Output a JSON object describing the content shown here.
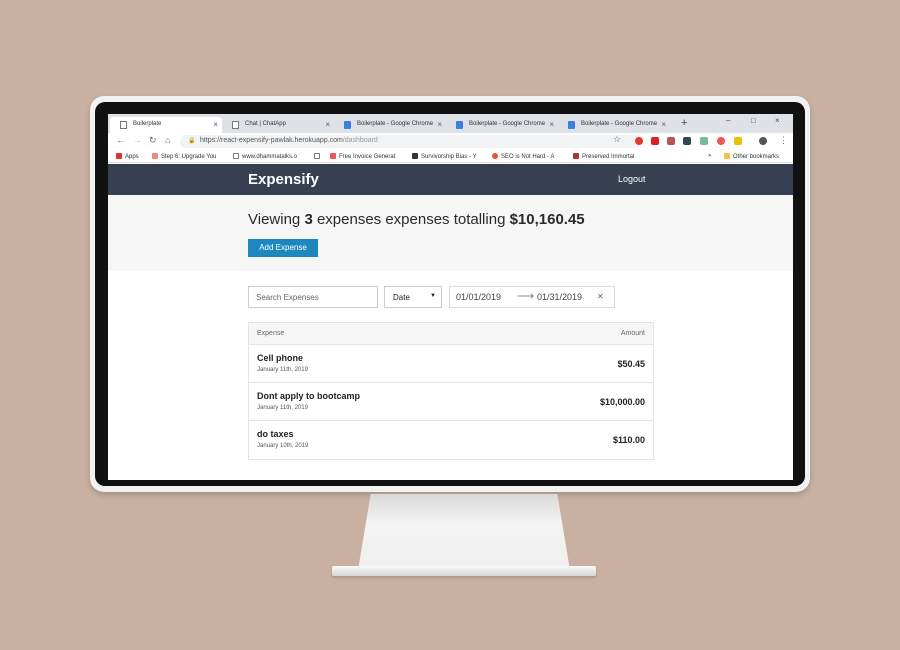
{
  "browser": {
    "tabs": [
      {
        "label": "Boilerplate",
        "favicon": "page-icon",
        "active": true
      },
      {
        "label": "Chat | ChatApp",
        "favicon": "page-icon",
        "active": false
      },
      {
        "label": "Boilerplate - Google Chrome",
        "favicon": "chrome-window-icon",
        "active": false
      },
      {
        "label": "Boilerplate - Google Chrome",
        "favicon": "chrome-window-icon",
        "active": false
      },
      {
        "label": "Boilerplate - Google Chrome",
        "favicon": "chrome-window-icon",
        "active": false
      }
    ],
    "url_host": "https://react-expensify-pawlak.herokuapp.com",
    "url_path": "/dashboard",
    "bookmarks": [
      {
        "label": "Apps",
        "icon": "apps-grid-icon"
      },
      {
        "label": "Step 6: Upgrade You",
        "icon": "bookmark-icon"
      },
      {
        "label": "www.dhammatalks.o",
        "icon": "page-icon"
      },
      {
        "label": "",
        "icon": "page-icon"
      },
      {
        "label": "Free Invoice Generat",
        "icon": "bookmark-icon"
      },
      {
        "label": "Survivorship Bias - Y",
        "icon": "bookmark-icon"
      },
      {
        "label": "SEO is Not Hard - A",
        "icon": "bookmark-icon"
      },
      {
        "label": "Preserved Immortal",
        "icon": "bookmark-icon"
      },
      {
        "label": "»",
        "icon": ""
      },
      {
        "label": "Other bookmarks",
        "icon": "folder-icon"
      }
    ]
  },
  "app": {
    "brand": "Expensify",
    "logout_label": "Logout",
    "summary": {
      "prefix": "Viewing ",
      "count": "3",
      "middle": " expenses expenses totalling ",
      "total": "$10,160.45"
    },
    "add_expense_label": "Add Expense",
    "filters": {
      "search_placeholder": "Search Expenses",
      "sort_value": "Date",
      "start_date": "01/01/2019",
      "end_date": "01/31/2019"
    },
    "list": {
      "header_expense": "Expense",
      "header_amount": "Amount",
      "items": [
        {
          "description": "Cell phone",
          "date": "January 11th, 2019",
          "amount": "$50.45"
        },
        {
          "description": "Dont apply to bootcamp",
          "date": "January 11th, 2019",
          "amount": "$10,000.00"
        },
        {
          "description": "do taxes",
          "date": "January 10th, 2019",
          "amount": "$110.00"
        }
      ]
    }
  },
  "colors": {
    "background": "#c9b0a1",
    "header": "#364051",
    "accent": "#1c88bf"
  }
}
